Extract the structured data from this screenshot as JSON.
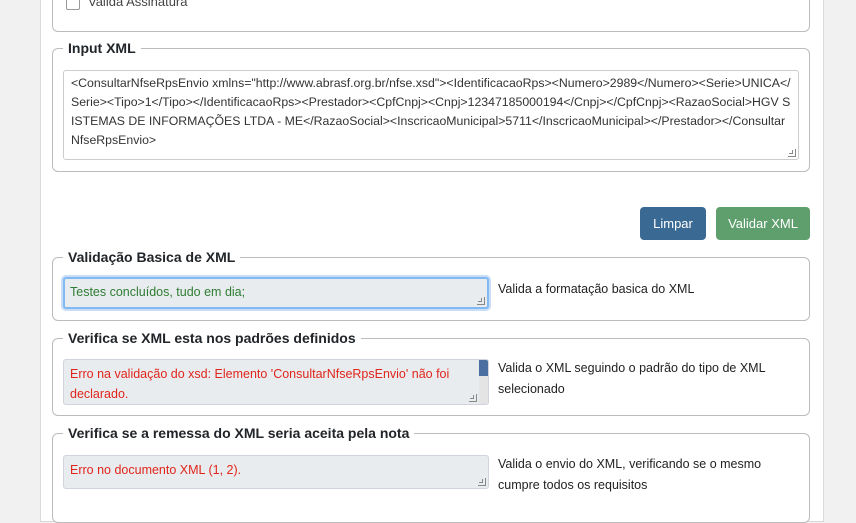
{
  "signature": {
    "label": "Valida Assinatura",
    "checked": false
  },
  "input_xml": {
    "legend": "Input XML",
    "value": "<ConsultarNfseRpsEnvio xmlns=\"http://www.abrasf.org.br/nfse.xsd\"><IdentificacaoRps><Numero>2989</Numero><Serie>UNICA</Serie><Tipo>1</Tipo></IdentificacaoRps><Prestador><CpfCnpj><Cnpj>12347185000194</Cnpj></CpfCnpj><RazaoSocial>HGV SISTEMAS DE INFORMAÇÕES LTDA - ME</RazaoSocial><InscricaoMunicipal>5711</InscricaoMunicipal></Prestador></ConsultarNfseRpsEnvio>"
  },
  "buttons": {
    "clear": "Limpar",
    "validate": "Validar XML"
  },
  "sections": [
    {
      "legend": "Validação Basica de XML",
      "result": "Testes concluídos, tudo em dia;",
      "status": "ok",
      "description": "Valida a formatação basica do XML"
    },
    {
      "legend": "Verifica se XML esta nos padrões definidos",
      "result": "Erro na validação do xsd: Elemento 'ConsultarNfseRpsEnvio' não foi declarado.",
      "status": "error",
      "description": "Valida o XML seguindo o padrão do tipo de XML selecionado"
    },
    {
      "legend": "Verifica se a remessa do XML seria aceita pela nota",
      "result": "Erro no documento XML (1, 2).",
      "status": "error",
      "description": "Valida o envio do XML, verificando se o mesmo cumpre todos os requisitos"
    }
  ],
  "colors": {
    "clear_button": "#3a6a93",
    "validate_button": "#5f9e6d",
    "ok_text": "#2e7d32",
    "error_text": "#e0251b"
  }
}
